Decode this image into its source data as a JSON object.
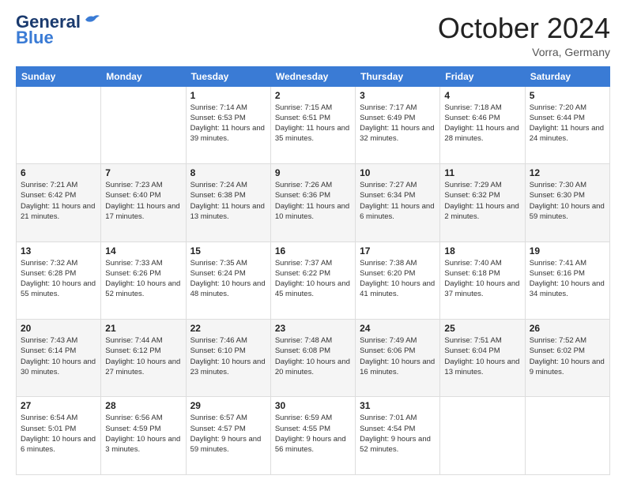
{
  "header": {
    "logo_line1": "General",
    "logo_line2": "Blue",
    "month": "October 2024",
    "location": "Vorra, Germany"
  },
  "weekdays": [
    "Sunday",
    "Monday",
    "Tuesday",
    "Wednesday",
    "Thursday",
    "Friday",
    "Saturday"
  ],
  "weeks": [
    [
      {
        "day": "",
        "info": ""
      },
      {
        "day": "",
        "info": ""
      },
      {
        "day": "1",
        "info": "Sunrise: 7:14 AM\nSunset: 6:53 PM\nDaylight: 11 hours and 39 minutes."
      },
      {
        "day": "2",
        "info": "Sunrise: 7:15 AM\nSunset: 6:51 PM\nDaylight: 11 hours and 35 minutes."
      },
      {
        "day": "3",
        "info": "Sunrise: 7:17 AM\nSunset: 6:49 PM\nDaylight: 11 hours and 32 minutes."
      },
      {
        "day": "4",
        "info": "Sunrise: 7:18 AM\nSunset: 6:46 PM\nDaylight: 11 hours and 28 minutes."
      },
      {
        "day": "5",
        "info": "Sunrise: 7:20 AM\nSunset: 6:44 PM\nDaylight: 11 hours and 24 minutes."
      }
    ],
    [
      {
        "day": "6",
        "info": "Sunrise: 7:21 AM\nSunset: 6:42 PM\nDaylight: 11 hours and 21 minutes."
      },
      {
        "day": "7",
        "info": "Sunrise: 7:23 AM\nSunset: 6:40 PM\nDaylight: 11 hours and 17 minutes."
      },
      {
        "day": "8",
        "info": "Sunrise: 7:24 AM\nSunset: 6:38 PM\nDaylight: 11 hours and 13 minutes."
      },
      {
        "day": "9",
        "info": "Sunrise: 7:26 AM\nSunset: 6:36 PM\nDaylight: 11 hours and 10 minutes."
      },
      {
        "day": "10",
        "info": "Sunrise: 7:27 AM\nSunset: 6:34 PM\nDaylight: 11 hours and 6 minutes."
      },
      {
        "day": "11",
        "info": "Sunrise: 7:29 AM\nSunset: 6:32 PM\nDaylight: 11 hours and 2 minutes."
      },
      {
        "day": "12",
        "info": "Sunrise: 7:30 AM\nSunset: 6:30 PM\nDaylight: 10 hours and 59 minutes."
      }
    ],
    [
      {
        "day": "13",
        "info": "Sunrise: 7:32 AM\nSunset: 6:28 PM\nDaylight: 10 hours and 55 minutes."
      },
      {
        "day": "14",
        "info": "Sunrise: 7:33 AM\nSunset: 6:26 PM\nDaylight: 10 hours and 52 minutes."
      },
      {
        "day": "15",
        "info": "Sunrise: 7:35 AM\nSunset: 6:24 PM\nDaylight: 10 hours and 48 minutes."
      },
      {
        "day": "16",
        "info": "Sunrise: 7:37 AM\nSunset: 6:22 PM\nDaylight: 10 hours and 45 minutes."
      },
      {
        "day": "17",
        "info": "Sunrise: 7:38 AM\nSunset: 6:20 PM\nDaylight: 10 hours and 41 minutes."
      },
      {
        "day": "18",
        "info": "Sunrise: 7:40 AM\nSunset: 6:18 PM\nDaylight: 10 hours and 37 minutes."
      },
      {
        "day": "19",
        "info": "Sunrise: 7:41 AM\nSunset: 6:16 PM\nDaylight: 10 hours and 34 minutes."
      }
    ],
    [
      {
        "day": "20",
        "info": "Sunrise: 7:43 AM\nSunset: 6:14 PM\nDaylight: 10 hours and 30 minutes."
      },
      {
        "day": "21",
        "info": "Sunrise: 7:44 AM\nSunset: 6:12 PM\nDaylight: 10 hours and 27 minutes."
      },
      {
        "day": "22",
        "info": "Sunrise: 7:46 AM\nSunset: 6:10 PM\nDaylight: 10 hours and 23 minutes."
      },
      {
        "day": "23",
        "info": "Sunrise: 7:48 AM\nSunset: 6:08 PM\nDaylight: 10 hours and 20 minutes."
      },
      {
        "day": "24",
        "info": "Sunrise: 7:49 AM\nSunset: 6:06 PM\nDaylight: 10 hours and 16 minutes."
      },
      {
        "day": "25",
        "info": "Sunrise: 7:51 AM\nSunset: 6:04 PM\nDaylight: 10 hours and 13 minutes."
      },
      {
        "day": "26",
        "info": "Sunrise: 7:52 AM\nSunset: 6:02 PM\nDaylight: 10 hours and 9 minutes."
      }
    ],
    [
      {
        "day": "27",
        "info": "Sunrise: 6:54 AM\nSunset: 5:01 PM\nDaylight: 10 hours and 6 minutes."
      },
      {
        "day": "28",
        "info": "Sunrise: 6:56 AM\nSunset: 4:59 PM\nDaylight: 10 hours and 3 minutes."
      },
      {
        "day": "29",
        "info": "Sunrise: 6:57 AM\nSunset: 4:57 PM\nDaylight: 9 hours and 59 minutes."
      },
      {
        "day": "30",
        "info": "Sunrise: 6:59 AM\nSunset: 4:55 PM\nDaylight: 9 hours and 56 minutes."
      },
      {
        "day": "31",
        "info": "Sunrise: 7:01 AM\nSunset: 4:54 PM\nDaylight: 9 hours and 52 minutes."
      },
      {
        "day": "",
        "info": ""
      },
      {
        "day": "",
        "info": ""
      }
    ]
  ]
}
